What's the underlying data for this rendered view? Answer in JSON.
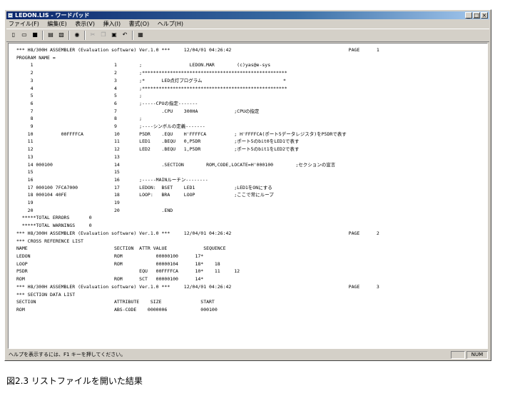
{
  "window": {
    "title": "LEDON.LIS - ワードパッド",
    "buttons": {
      "minimize": "_",
      "maximize": "□",
      "close": "×"
    }
  },
  "menubar": {
    "items": [
      "ファイル(F)",
      "編集(E)",
      "表示(V)",
      "挿入(I)",
      "書式(O)",
      "ヘルプ(H)"
    ]
  },
  "toolbar": {
    "icons": [
      "new-icon",
      "open-icon",
      "save-icon",
      "print-icon",
      "print-preview-icon",
      "find-icon",
      "cut-icon",
      "copy-icon",
      "paste-icon",
      "undo-icon",
      "date-time-icon"
    ]
  },
  "document": {
    "lines": [
      "*** H8/300H ASSEMBLER (Evaluation software) Ver.1.0 ***     12/04/01 04:26:42                                          PAGE      1",
      "PROGRAM NAME =",
      "     1                             1        ;                 LEDON.MAR        (c)yas@e-sys",
      "     2                             2        ;****************************************************",
      "     3                             3        ;*      LED点灯プログラム                             *",
      "     4                             4        ;****************************************************",
      "     5                             5        ;",
      "     6                             6        ;-----CPUの指定-------",
      "     7                             7                .CPU    300HA             ;CPUの指定",
      "     8                             8        ;",
      "     9                             9        ;----シンボルの定義-------",
      "    10          00FFFFCA           10       P5DR    .EQU    H'FFFFCA          ; H'FFFFCA(ポート5データレジスタ)をP5DRで表す",
      "    11                             11       LED1    .BEQU   0,P5DR            ;ポート5のbit0をLED1で表す",
      "    12                             12       LED2    .BEQU   1,P5DR            ;ポート5のbit1をLED2で表す",
      "    13                             13",
      "    14 000100                      14               .SECTION        ROM,CODE,LOCATE=H'000100        ;セクションの宣言",
      "    15                             15",
      "    16                             16       ;-----MAINルーチン--------",
      "    17 000100 7FCA7000             17       LEDON:  BSET    LED1              ;LED1をONにする",
      "    18 000104 40FE                 18       LOOP:   BRA     LOOP              ;ここで常にループ",
      "    19                             19",
      "    20                             20               .END",
      "  *****TOTAL ERRORS       0",
      "  *****TOTAL WARNINGS     0",
      "*** H8/300H ASSEMBLER (Evaluation software) Ver.1.0 ***     12/04/01 04:26:42                                          PAGE      2",
      "*** CROSS REFERENCE LIST",
      "NAME                               SECTION  ATTR VALUE             SEQUENCE",
      "LEDON                              ROM            00000100      17*",
      "LOOP                               ROM            00000104      18*    18",
      "P5DR                                        EQU   00FFFFCA      10*    11     12",
      "ROM                                ROM      SCT   00000100      14*",
      "*** H8/300H ASSEMBLER (Evaluation software) Ver.1.0 ***     12/04/01 04:26:42                                          PAGE      3",
      "*** SECTION DATA LIST",
      "SECTION                            ATTRIBUTE    SIZE              START",
      "ROM                                ABS-CODE    0000006            000100"
    ]
  },
  "statusbar": {
    "help_text": "ヘルプを表示するには、F1 キーを押してください。",
    "num_indicator": "NUM"
  },
  "caption": "図2.3  リストファイルを開いた結果"
}
